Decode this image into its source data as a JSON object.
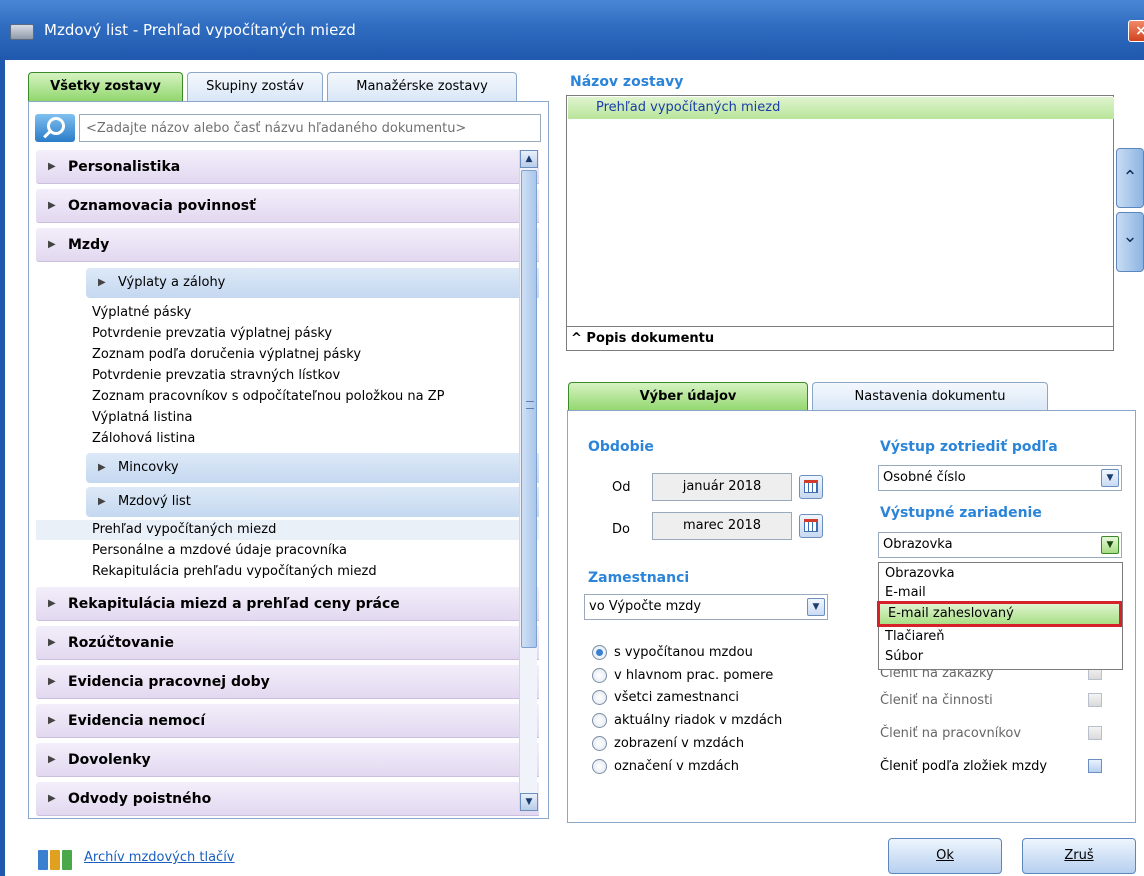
{
  "window": {
    "title": "Mzdový list - Prehľad vypočítaných miezd",
    "close_label": "×"
  },
  "left_tabs": [
    "Všetky zostavy",
    "Skupiny zostáv",
    "Manažérske zostavy"
  ],
  "search": {
    "placeholder": "<Zadajte názov alebo časť názvu hľadaného dokumentu>"
  },
  "tree": {
    "categories_top": [
      "Personalistika",
      "Oznamovacia povinnosť",
      "Mzdy"
    ],
    "mzdy": {
      "groups": [
        {
          "label": "Výplaty a zálohy",
          "items": [
            "Výplatné pásky",
            "Potvrdenie prevzatia výplatnej pásky",
            "Zoznam podľa doručenia výplatnej pásky",
            "Potvrdenie prevzatia stravných lístkov",
            "Zoznam pracovníkov s odpočítateľnou položkou na ZP",
            "Výplatná listina",
            "Zálohová listina"
          ]
        },
        {
          "label": "Mincovky",
          "items": []
        },
        {
          "label": "Mzdový list",
          "items": [
            "Prehľad vypočítaných miezd",
            "Personálne a mzdové údaje pracovníka",
            "Rekapitulácia prehľadu vypočítaných miezd"
          ]
        }
      ]
    },
    "categories_bottom": [
      "Rekapitulácia miezd a prehľad ceny práce",
      "Rozúčtovanie",
      "Evidencia pracovnej doby",
      "Evidencia nemocí",
      "Dovolenky",
      "Odvody poistného"
    ]
  },
  "report": {
    "label": "Názov zostavy",
    "selected": "Prehľad vypočítaných miezd",
    "description_toggle": "^ Popis dokumentu"
  },
  "right_tabs": [
    "Výber údajov",
    "Nastavenia dokumentu"
  ],
  "period": {
    "label": "Obdobie",
    "from_label": "Od",
    "from_value": "január 2018",
    "to_label": "Do",
    "to_value": "marec 2018"
  },
  "employees": {
    "label": "Zamestnanci",
    "selected": "vo Výpočte mzdy",
    "radios": [
      "s vypočítanou mzdou",
      "v hlavnom prac. pomere",
      "všetci zamestnanci",
      "aktuálny riadok v mzdách",
      "zobrazení v mzdách",
      "označení v mzdách"
    ],
    "selected_index": 0
  },
  "sort": {
    "label": "Výstup zotriediť podľa",
    "selected": "Osobné číslo"
  },
  "output_device": {
    "label": "Výstupné zariadenie",
    "selected": "Obrazovka",
    "options": [
      "Obrazovka",
      "E-mail",
      "E-mail zaheslovaný",
      "Tlačiareň",
      "Súbor"
    ],
    "highlighted_index": 2
  },
  "split_options": [
    {
      "label": "Členiť na zákazky",
      "checked": false
    },
    {
      "label": "Členiť na činnosti",
      "checked": false
    },
    {
      "label": "Členiť na pracovníkov",
      "checked": false
    },
    {
      "label": "Členiť podľa zložiek mzdy",
      "checked": false
    }
  ],
  "footer": {
    "archive_link": "Archív mzdových tlačív",
    "ok_label": "Ok",
    "cancel_label": "Zruš"
  },
  "colors": {
    "accent_blue": "#2b84d8",
    "active_green": "#8fd66a",
    "highlight_red": "#d6202a",
    "titlebar": "#2f6cc0"
  }
}
